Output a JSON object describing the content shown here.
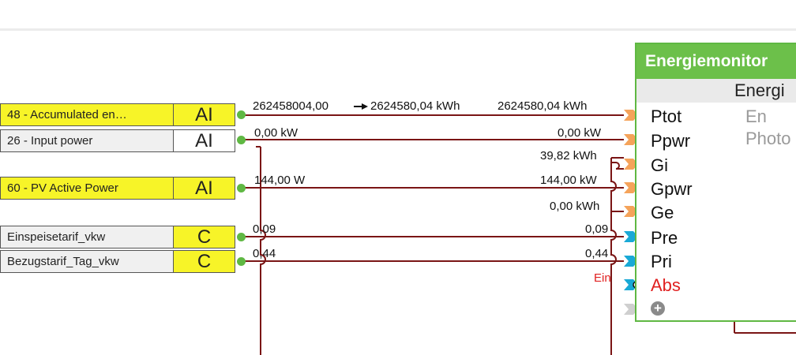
{
  "inputs": [
    {
      "name": "48 - Accumulated en…",
      "type": "AI",
      "style": "yellow"
    },
    {
      "name": "26 - Input power",
      "type": "AI",
      "style": "white"
    },
    {
      "name": "60 - PV Active Power",
      "type": "AI",
      "style": "yellow"
    },
    {
      "name": "Einspeisetarif_vkw",
      "type": "C",
      "style": "white"
    },
    {
      "name": "Bezugstarif_Tag_vkw",
      "type": "C",
      "style": "white"
    }
  ],
  "wire_labels": {
    "accumulated_left": "262458004,00",
    "accumulated_mid": "2624580,04 kWh",
    "accumulated_right": "2624580,04 kWh",
    "input_power_left": "0,00 kW",
    "input_power_right": "0,00 kW",
    "gi_value": "39,82 kWh",
    "pv_left": "144,00 W",
    "pv_right": "144,00 kW",
    "ge_value": "0,00 kWh",
    "einspeise_left": "0,09",
    "einspeise_right": "0,09",
    "bezug_left": "0,44",
    "bezug_right": "0,44",
    "ein": "Ein"
  },
  "monitor": {
    "title": "Energiemonitor",
    "subtitle": "Energi",
    "pins": [
      {
        "label": "Ptot",
        "desc": "En"
      },
      {
        "label": "Ppwr",
        "desc": "Photo"
      },
      {
        "label": "Gi",
        "desc": ""
      },
      {
        "label": "Gpwr",
        "desc": ""
      },
      {
        "label": "Ge",
        "desc": ""
      },
      {
        "label": "Pre",
        "desc": ""
      },
      {
        "label": "Pri",
        "desc": ""
      },
      {
        "label": "Abs",
        "desc": ""
      }
    ],
    "add_icon": "plus-circle-icon"
  },
  "colors": {
    "wire": "#7a1515",
    "connector_green": "#5fb843",
    "pin_orange": "#f5a35a",
    "pin_blue": "#19a9d6",
    "pin_grey": "#cfcfcf",
    "monitor_header": "#6cc04a",
    "yellow": "#f7f428"
  }
}
